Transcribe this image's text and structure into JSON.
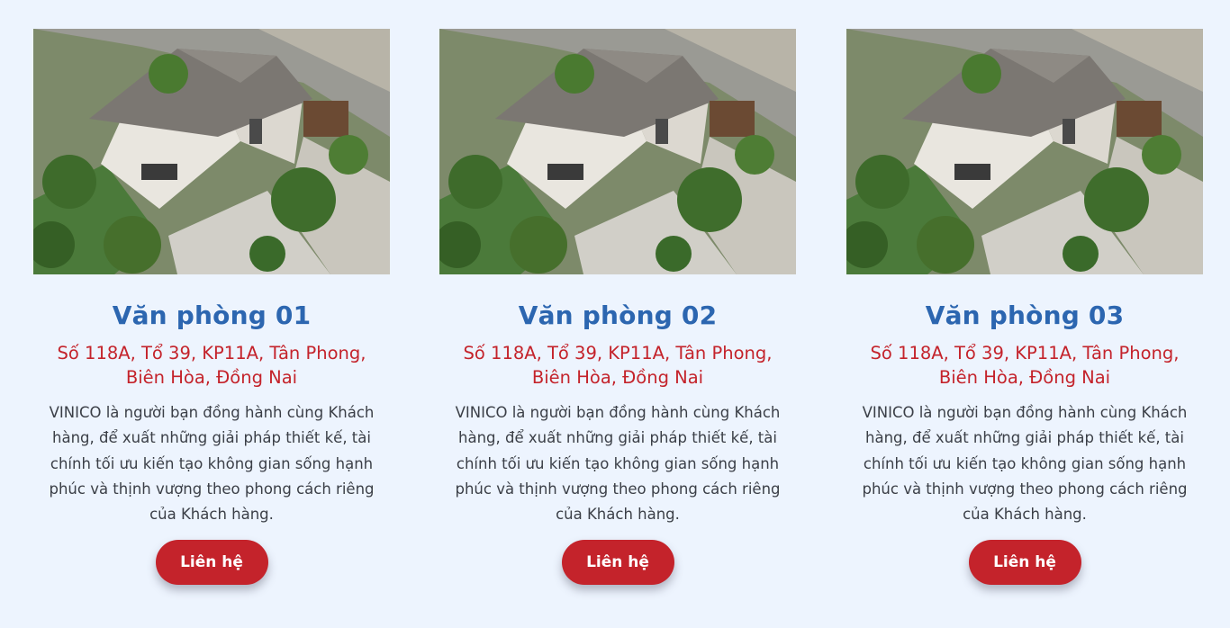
{
  "colors": {
    "background": "#edf4fe",
    "title": "#2c66b0",
    "address": "#c4232b",
    "text": "#3b3f47",
    "button": "#c4232b"
  },
  "offices": [
    {
      "image_alt": "house-render",
      "title": "Văn phòng 01",
      "address": "Số 118A, Tổ 39, KP11A, Tân Phong, Biên Hòa, Đồng Nai",
      "description": "VINICO là người bạn đồng hành cùng Khách hàng, để xuất những giải pháp thiết kế, tài chính tối ưu kiến tạo không gian sống hạnh phúc và thịnh vượng theo phong cách riêng của Khách hàng.",
      "button_label": "Liên hệ"
    },
    {
      "image_alt": "house-render",
      "title": "Văn phòng 02",
      "address": "Số 118A, Tổ 39, KP11A, Tân Phong, Biên Hòa, Đồng Nai",
      "description": "VINICO là người bạn đồng hành cùng Khách hàng, để xuất những giải pháp thiết kế, tài chính tối ưu kiến tạo không gian sống hạnh phúc và thịnh vượng theo phong cách riêng của Khách hàng.",
      "button_label": "Liên hệ"
    },
    {
      "image_alt": "house-render",
      "title": "Văn phòng 03",
      "address": "Số 118A, Tổ 39, KP11A, Tân Phong, Biên Hòa, Đồng Nai",
      "description": "VINICO là người bạn đồng hành cùng Khách hàng, để xuất những giải pháp thiết kế, tài chính tối ưu kiến tạo không gian sống hạnh phúc và thịnh vượng theo phong cách riêng của Khách hàng.",
      "button_label": "Liên hệ"
    }
  ]
}
